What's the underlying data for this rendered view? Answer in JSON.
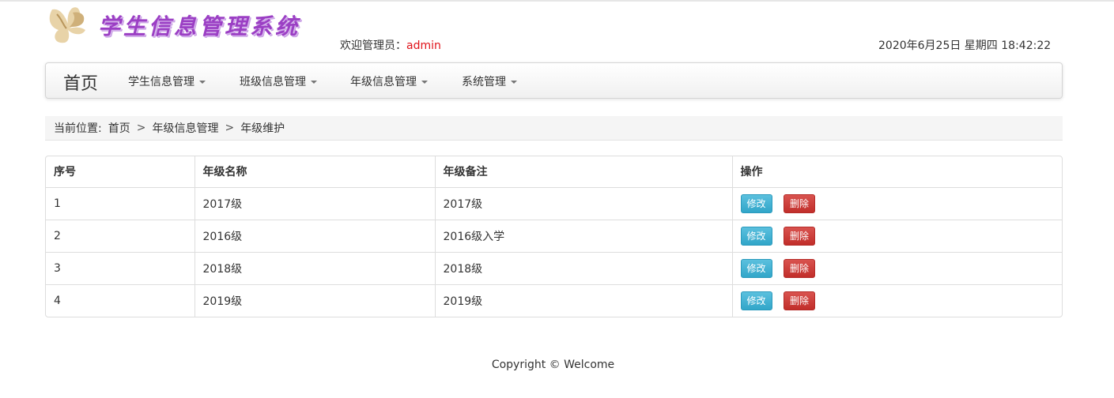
{
  "header": {
    "logo_title": "学生信息管理系统",
    "welcome_prefix": "欢迎管理员：",
    "username": "admin",
    "datetime": "2020年6月25日 星期四 18:42:22"
  },
  "navbar": {
    "brand": "首页",
    "items": [
      {
        "label": "学生信息管理"
      },
      {
        "label": "班级信息管理"
      },
      {
        "label": "年级信息管理"
      },
      {
        "label": "系统管理"
      }
    ]
  },
  "breadcrumb": {
    "label": "当前位置:",
    "items": [
      "首页",
      "年级信息管理",
      "年级维护"
    ],
    "separator": ">"
  },
  "table": {
    "columns": [
      "序号",
      "年级名称",
      "年级备注",
      "操作"
    ],
    "rows": [
      {
        "no": "1",
        "name": "2017级",
        "remark": "2017级"
      },
      {
        "no": "2",
        "name": "2016级",
        "remark": "2016级入学"
      },
      {
        "no": "3",
        "name": "2018级",
        "remark": "2018级"
      },
      {
        "no": "4",
        "name": "2019级",
        "remark": "2019级"
      }
    ],
    "edit_label": "修改",
    "delete_label": "删除"
  },
  "footer": {
    "text": "Copyright © Welcome"
  },
  "colors": {
    "username": "#e0131a",
    "logo_text": "#9b3fc4",
    "edit_button": "#5bc0de",
    "delete_button": "#d9534f"
  }
}
